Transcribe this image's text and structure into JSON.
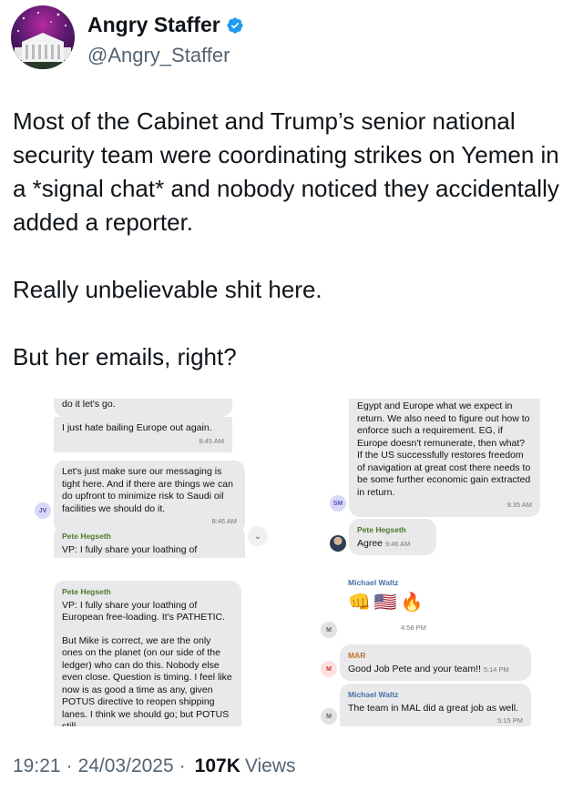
{
  "author": {
    "display_name": "Angry Staffer",
    "handle": "@Angry_Staffer",
    "avatar_icon": "white-house-icon",
    "verified_icon": "verified-badge-icon",
    "verified_color": "#1d9bf0"
  },
  "tweet": {
    "paragraphs": [
      "Most of the Cabinet and Trump’s senior national security team were coordinating strikes on Yemen in a *signal chat* and nobody noticed they accidentally added a reporter.",
      "Really unbelievable shit here.",
      "But her emails, right?"
    ]
  },
  "media": {
    "top_left": {
      "partial_top": "do it let's go.",
      "msg1": "I just hate bailing Europe out again.",
      "msg1_time": "8:45 AM",
      "msg2": "Let's just make sure our messaging is tight here. And if there are things we can do upfront to minimize risk to Saudi oil facilities we should do it.",
      "msg2_time": "8:46 AM",
      "msg2_initials": "JV",
      "msg3_sender": "Pete Hegseth",
      "msg3": "VP: I fully share your loathing of"
    },
    "top_right": {
      "msg1": "Egypt and Europe what we expect in return. We also need to figure out how to enforce such a requirement. EG, if Europe doesn't remunerate, then what? If the US successfully restores freedom of navigation at great cost there needs to be some further economic gain extracted in return.",
      "msg1_time": "9:35 AM",
      "msg1_initials": "SM",
      "msg2_sender": "Pete Hegseth",
      "msg2": "Agree",
      "msg2_time": "9:46 AM"
    },
    "bottom_left": {
      "sender": "Pete Hegseth",
      "msg1": "VP: I fully share your loathing of European free-loading. It's PATHETIC.",
      "msg2": "But Mike is correct, we are the only ones on the planet (on our side of the ledger) who can do this. Nobody else even close. Question is timing. I feel like now is as good a time as any, given POTUS directive to reopen shipping lanes. I think we should go; but POTUS still"
    },
    "bottom_right": {
      "sender1": "Michael Waltz",
      "emojis": "👊🇺🇸🔥",
      "emoji_time": "4:58 PM",
      "initials_m": "M",
      "sender2": "MAR",
      "msg2": "Good Job Pete and your team!!",
      "msg2_time": "5:14 PM",
      "sender3": "Michael Waltz",
      "msg3": "The team in MAL did a great job as well.",
      "msg3_time": "5:15 PM"
    }
  },
  "footer": {
    "time": "19:21",
    "date": "24/03/2025",
    "views_count": "107K",
    "views_label": "Views"
  }
}
